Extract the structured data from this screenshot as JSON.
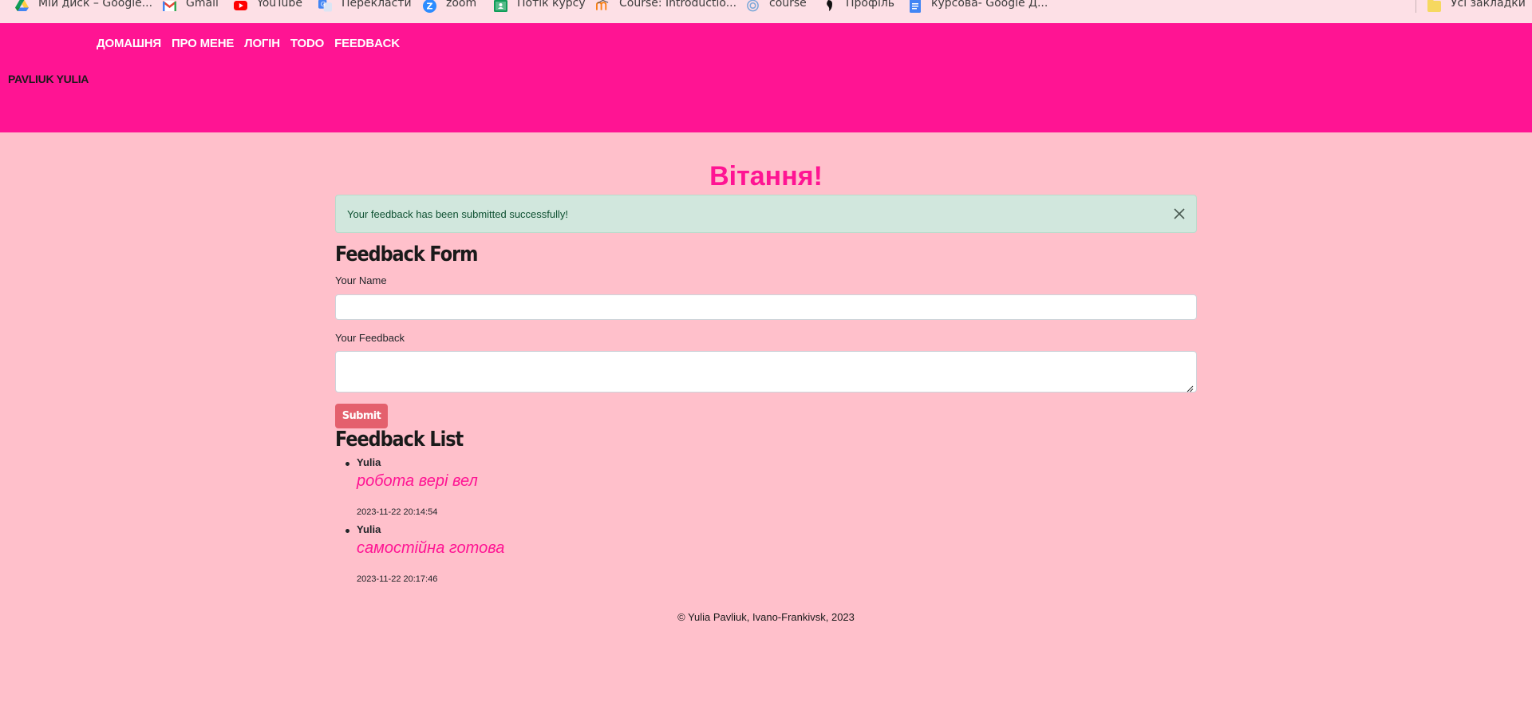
{
  "bookmarks": {
    "items": [
      {
        "label": "Мій диск – Google...",
        "icon": "google-drive-icon"
      },
      {
        "label": "Gmail",
        "icon": "gmail-icon"
      },
      {
        "label": "YouTube",
        "icon": "youtube-icon"
      },
      {
        "label": "Перекласти",
        "icon": "translate-icon"
      },
      {
        "label": "zoom",
        "icon": "zoom-icon"
      },
      {
        "label": "Потік курсу",
        "icon": "classroom-icon"
      },
      {
        "label": "Course: Introductio...",
        "icon": "moodle-icon"
      },
      {
        "label": "course",
        "icon": "course-icon"
      },
      {
        "label": "Профіль",
        "icon": "profile-icon"
      },
      {
        "label": "курсова- Google Д...",
        "icon": "google-docs-icon"
      }
    ],
    "all_bookmarks": "Усі закладки"
  },
  "header": {
    "nav": [
      "Домашня",
      "Про мене",
      "Логін",
      "Todo",
      "Feedback"
    ],
    "brand": "Pavliuk Yulia",
    "color": "#ff1493"
  },
  "main": {
    "greeting": "Вітання!",
    "alert": "Your feedback has been submitted successfully!",
    "form": {
      "title": "Feedback Form",
      "name_label": "Your Name",
      "name_value": "",
      "feedback_label": "Your Feedback",
      "feedback_value": "",
      "submit_label": "Submit"
    },
    "list": {
      "title": "Feedback List",
      "items": [
        {
          "name": "Yulia",
          "message": "робота вері вел",
          "timestamp": "2023-11-22 20:14:54"
        },
        {
          "name": "Yulia",
          "message": "самостійна готова",
          "timestamp": "2023-11-22 20:17:46"
        }
      ]
    }
  },
  "footer": "© Yulia Pavliuk, Ivano-Frankivsk, 2023",
  "colors": {
    "page_bg": "#ffc0cb",
    "accent": "#ff1493",
    "alert_bg": "#d1e7dd",
    "submit_bg": "#e4606d"
  }
}
